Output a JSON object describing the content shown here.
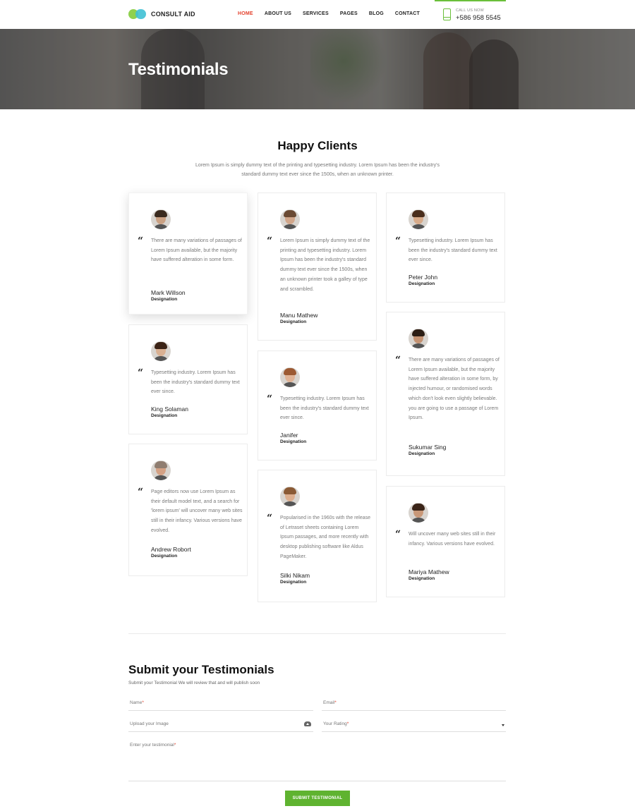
{
  "header": {
    "brand": "CONSULT AID",
    "nav": [
      {
        "label": "HOME",
        "active": true
      },
      {
        "label": "ABOUT US",
        "active": false
      },
      {
        "label": "SERVICES",
        "active": false
      },
      {
        "label": "PAGES",
        "active": false
      },
      {
        "label": "BLOG",
        "active": false
      },
      {
        "label": "CONTACT",
        "active": false
      }
    ],
    "call_label": "CALL US NOW",
    "phone": "+586 958 5545",
    "accent_color": "#6abf3a",
    "active_color": "#e4432e"
  },
  "hero": {
    "title": "Testimonials"
  },
  "intro": {
    "title": "Happy Clients",
    "subtitle": "Lorem Ipsum is simply dummy text of the printing and typesetting industry. Lorem Ipsum has been the industry's standard dummy text ever since the 1500s, when an unknown printer."
  },
  "testimonials": [
    {
      "name": "Mark Willson",
      "designation": "Designation",
      "text": "There are many variations of passages of Lorem Ipsum available, but the majority have suffered alteration in some form.",
      "quote_icon": "left-double-quote"
    },
    {
      "name": "Manu Mathew",
      "designation": "Designation",
      "text": "Lorem Ipsum is simply dummy text of the printing and typesetting industry. Lorem Ipsum has been the industry's standard dummy text ever since the 1500s, when an unknown printer took a galley of type and scrambled.",
      "quote_icon": "left-double-quote"
    },
    {
      "name": "Peter John",
      "designation": "Designation",
      "text": "Typesetting industry. Lorem Ipsum has been the industry's standard dummy text ever since.",
      "quote_icon": "left-double-quote"
    },
    {
      "name": "King Solaman",
      "designation": "Designation",
      "text": "Typesetting industry. Lorem Ipsum has been the industry's standard dummy text ever since.",
      "quote_icon": "left-double-quote"
    },
    {
      "name": "Janifer",
      "designation": "Designation",
      "text": "Typesetting industry. Lorem Ipsum has been the industry's standard dummy text ever since.",
      "quote_icon": "left-double-quote"
    },
    {
      "name": "Sukumar Sing",
      "designation": "Designation",
      "text": "There are many variations of passages of Lorem Ipsum available, but the majority have suffered alteration in some form, by injected humour, or randomised words which don't look even slightly believable. you are going to use a passage of Lorem Ipsum.",
      "quote_icon": "left-double-quote"
    },
    {
      "name": "Andrew Robort",
      "designation": "Designation",
      "text": "Page editors now use Lorem Ipsum as their default model text, and a search for 'lorem ipsum' will uncover many web sites still in their infancy. Various versions have evolved.",
      "quote_icon": "left-double-quote"
    },
    {
      "name": "Silki Nikam",
      "designation": "Designation",
      "text": "Popularised in the 1960s with the release of Letraset sheets containing Lorem Ipsum passages, and more recently with desktop publishing software like Aldus PageMaker.",
      "quote_icon": "left-double-quote"
    },
    {
      "name": "Mariya Mathew",
      "designation": "Designation",
      "text": "Will uncover many web sites still in their infancy. Various versions have evolved.",
      "quote_icon": "left-double-quote"
    }
  ],
  "form": {
    "title": "Submit your Testimonials",
    "subtitle": "Submit your Testimonial We will review that and will publish soon",
    "name_label": "Name",
    "email_label": "Email",
    "upload_label": "Upload your Image",
    "rating_label": "Your Rating",
    "testimonial_label": "Enter your testimonial",
    "required_mark": "*",
    "submit_label": "SUBMIT TESTIMONIAL",
    "submit_color": "#5fb330"
  }
}
